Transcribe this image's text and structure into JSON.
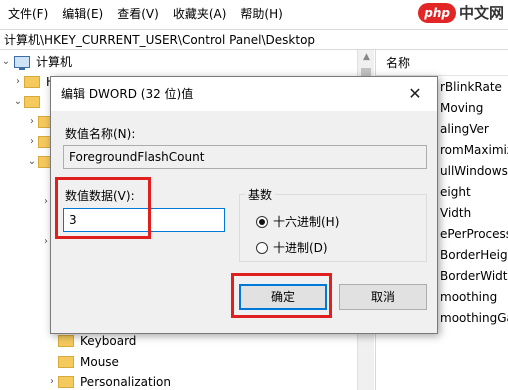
{
  "menubar": {
    "items": [
      "文件(F)",
      "编辑(E)",
      "查看(V)",
      "收藏夹(A)",
      "帮助(H)"
    ]
  },
  "watermark": {
    "badge": "php",
    "text": "中文网"
  },
  "address": {
    "path": "计算机\\HKEY_CURRENT_USER\\Control Panel\\Desktop"
  },
  "tree": {
    "root_label": "计算机",
    "partial_label": "HKEY_CLASSES_ROOT",
    "items": [
      {
        "label": "Keyboard"
      },
      {
        "label": "Mouse"
      },
      {
        "label": "Personalization"
      }
    ]
  },
  "values_pane": {
    "column_header": "名称",
    "items": [
      "rBlinkRate",
      "Moving",
      "alingVer",
      "romMaximiz",
      "ullWindows",
      "eight",
      "Vidth",
      "ePerProcessS",
      "BorderHeigh",
      "BorderWidth",
      "moothing",
      "moothingGar"
    ]
  },
  "dialog": {
    "title": "编辑 DWORD (32 位)值",
    "close_glyph": "✕",
    "value_name_label": "数值名称(N):",
    "value_name": "ForegroundFlashCount",
    "value_data_label": "数值数据(V):",
    "value_data": "3",
    "base": {
      "title": "基数",
      "options": [
        {
          "label": "十六进制(H)",
          "selected": true
        },
        {
          "label": "十进制(D)",
          "selected": false
        }
      ]
    },
    "ok_label": "确定",
    "cancel_label": "取消"
  },
  "colors": {
    "highlight": "#e0201e",
    "focus": "#0078d7"
  }
}
